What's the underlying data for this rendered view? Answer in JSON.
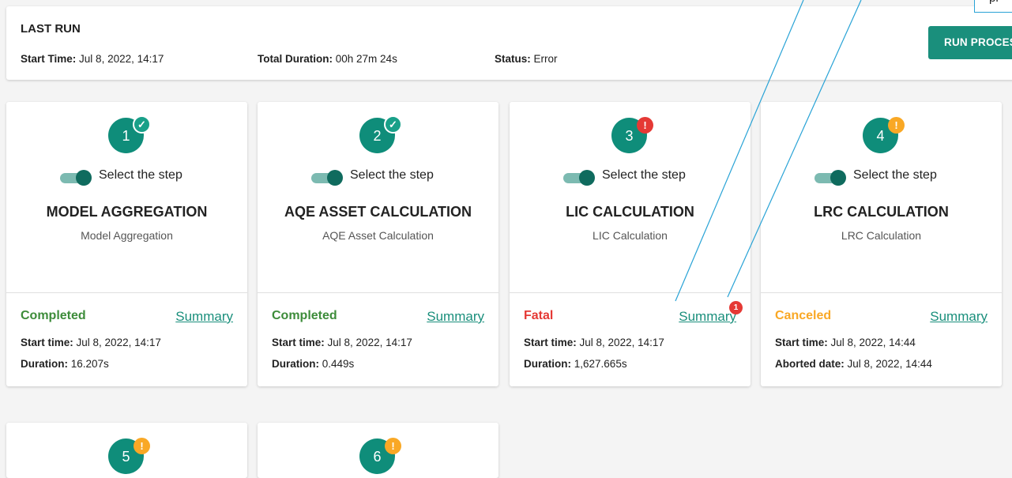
{
  "last_run": {
    "title": "LAST RUN",
    "start_time_label": "Start Time:",
    "start_time_value": "Jul 8, 2022, 14:17",
    "total_duration_label": "Total Duration:",
    "total_duration_value": "00h 27m 24s",
    "status_label": "Status:",
    "status_value": "Error",
    "run_button_label": "RUN PROCESS"
  },
  "tooltip": {
    "text": "pr"
  },
  "toggle_label": "Select the step",
  "summary_label": "Summary",
  "colors": {
    "accent": "#1a8f7c",
    "completed": "#3d8c3a",
    "fatal": "#e53935",
    "canceled": "#f9a825",
    "annotation": "#29a3d6"
  },
  "steps": [
    {
      "number": "1",
      "badge": "✓",
      "badge_type": "check-icon",
      "title": "MODEL AGGREGATION",
      "subtitle": "Model Aggregation",
      "status": "Completed",
      "line1_label": "Start time:",
      "line1_value": "Jul 8, 2022, 14:17",
      "line2_label": "Duration:",
      "line2_value": "16.207s"
    },
    {
      "number": "2",
      "badge": "✓",
      "badge_type": "check-icon",
      "title": "AQE ASSET CALCULATION",
      "subtitle": "AQE Asset Calculation",
      "status": "Completed",
      "line1_label": "Start time:",
      "line1_value": "Jul 8, 2022, 14:17",
      "line2_label": "Duration:",
      "line2_value": "0.449s"
    },
    {
      "number": "3",
      "badge": "!",
      "badge_type": "error-icon",
      "title": "LIC CALCULATION",
      "subtitle": "LIC Calculation",
      "status": "Fatal",
      "summary_count": "1",
      "line1_label": "Start time:",
      "line1_value": "Jul 8, 2022, 14:17",
      "line2_label": "Duration:",
      "line2_value": "1,627.665s"
    },
    {
      "number": "4",
      "badge": "!",
      "badge_type": "warning-icon",
      "title": "LRC CALCULATION",
      "subtitle": "LRC Calculation",
      "status": "Canceled",
      "line1_label": "Start time:",
      "line1_value": "Jul 8, 2022, 14:44",
      "line2_label": "Aborted date:",
      "line2_value": "Jul 8, 2022, 14:44"
    },
    {
      "number": "5",
      "badge": "!",
      "badge_type": "warning-icon"
    },
    {
      "number": "6",
      "badge": "!",
      "badge_type": "warning-icon"
    }
  ]
}
